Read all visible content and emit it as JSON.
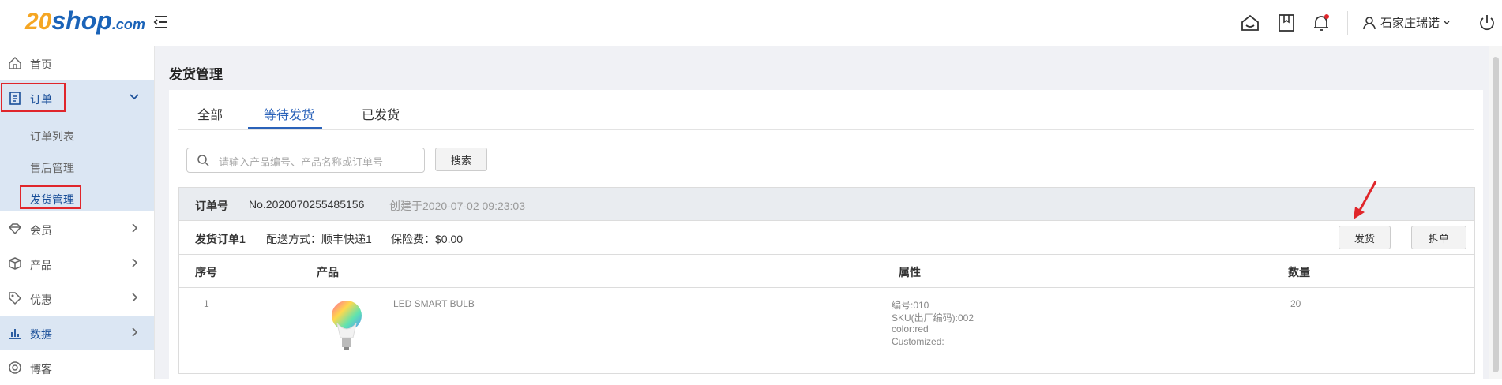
{
  "header": {
    "logo_prefix": "20",
    "logo_text": "shop",
    "logo_suffix": ".com",
    "user_name": "石家庄瑞诺"
  },
  "sidebar": {
    "items": [
      {
        "label": "首页",
        "icon": "home-icon"
      },
      {
        "label": "订单",
        "icon": "clipboard-icon"
      },
      {
        "label": "会员",
        "icon": "diamond-icon"
      },
      {
        "label": "产品",
        "icon": "box-icon"
      },
      {
        "label": "优惠",
        "icon": "tag-icon"
      },
      {
        "label": "数据",
        "icon": "bar-chart-icon"
      },
      {
        "label": "博客",
        "icon": "blog-icon"
      }
    ],
    "order_sub": [
      "订单列表",
      "售后管理",
      "发货管理"
    ]
  },
  "main": {
    "title": "发货管理",
    "tabs": [
      "全部",
      "等待发货",
      "已发货"
    ],
    "active_tab": 1,
    "search_placeholder": "请输入产品编号、产品名称或订单号",
    "search_button": "搜索"
  },
  "order": {
    "no_label": "订单号",
    "no_value": "No.2020070255485156",
    "created": "创建于2020-07-02 09:23:03",
    "ship_label": "发货订单1",
    "ship_method": "配送方式：顺丰快递1",
    "insurance": "保险费：$0.00",
    "ship_button": "发货",
    "split_button": "拆单",
    "columns": [
      "序号",
      "产品",
      "属性",
      "数量"
    ],
    "rows": [
      {
        "index": "1",
        "product": "LED SMART BULB",
        "attr_code": "编号:010",
        "attr_sku": "SKU(出厂编码):002",
        "attr_color": "color:red",
        "attr_custom": "Customized:",
        "qty": "20"
      }
    ]
  },
  "colors": {
    "accent": "#2a62b9",
    "highlight": "#e0262b",
    "sidebar_active": "#dbe6f3",
    "logo_orange": "#f5a623",
    "logo_blue": "#1a63b8"
  }
}
